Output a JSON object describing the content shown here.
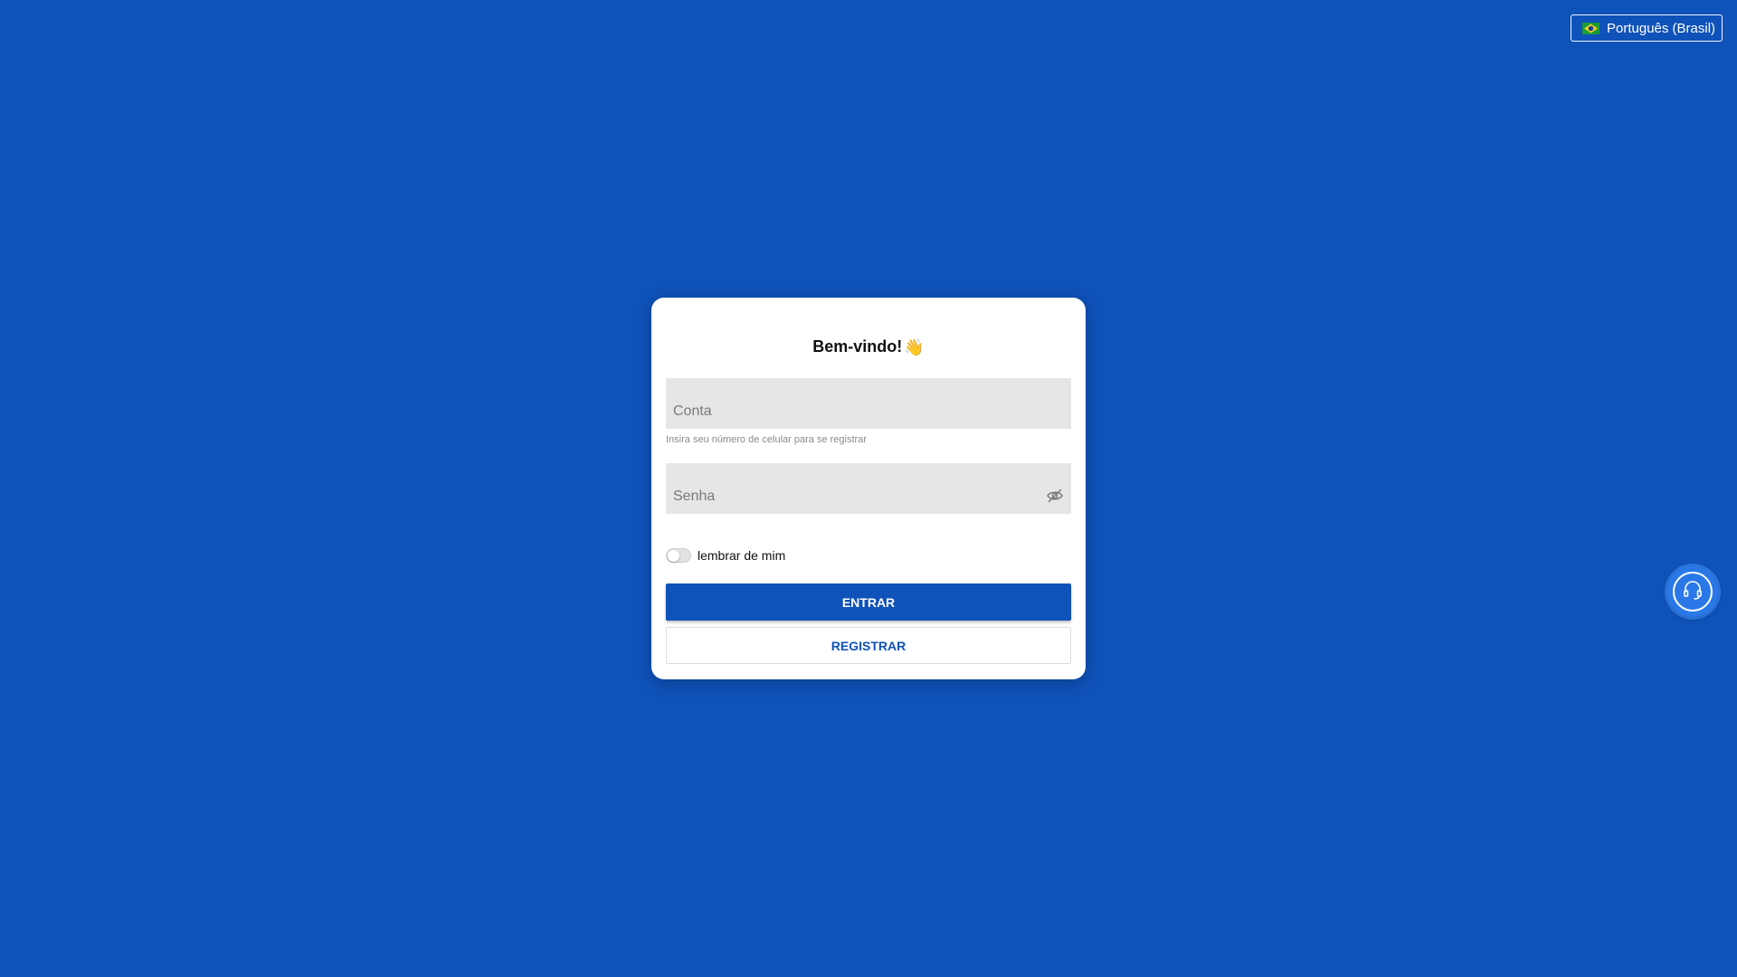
{
  "language": {
    "selected": "Português (Brasil)",
    "flag_icon": "brazil-flag-icon"
  },
  "login": {
    "title": "Bem-vindo!",
    "title_emoji": "👋",
    "account": {
      "placeholder": "Conta",
      "value": "",
      "helper": "Insira seu número de celular para se registrar"
    },
    "password": {
      "placeholder": "Senha",
      "value": "",
      "visibility_icon": "eye-off-icon"
    },
    "remember": {
      "label": "lembrar de mim",
      "checked": false
    },
    "login_button": "ENTRAR",
    "register_button": "REGISTRAR"
  },
  "support": {
    "icon": "headset-icon"
  },
  "colors": {
    "background": "#0f52b9",
    "primary": "#0f52b9",
    "card": "#ffffff",
    "field": "#e6e6e6",
    "support_button": "#2a78e8"
  }
}
